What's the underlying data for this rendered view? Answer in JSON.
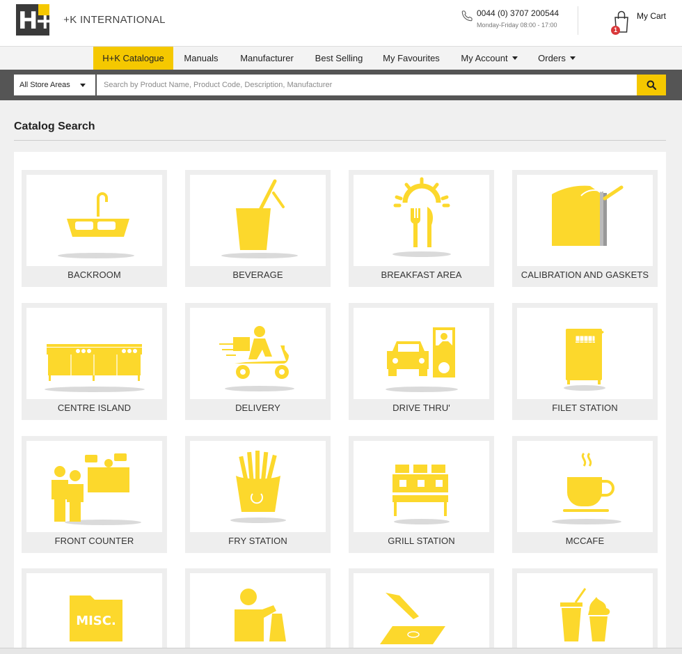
{
  "brand": {
    "logo_mark": "H+K",
    "name": "H+K INTERNATIONAL"
  },
  "contact": {
    "phone": "0044 (0) 3707 200544",
    "hours": "Monday-Friday 08:00 - 17:00",
    "icon": "phone-icon"
  },
  "cart": {
    "label": "My Cart",
    "count": "1",
    "icon": "shopping-bag-icon"
  },
  "nav": {
    "items": [
      {
        "label": "H+K Catalogue",
        "active": true,
        "dropdown": false
      },
      {
        "label": "Manuals",
        "active": false,
        "dropdown": false
      },
      {
        "label": "Manufacturer",
        "active": false,
        "dropdown": false
      },
      {
        "label": "Best Selling",
        "active": false,
        "dropdown": false
      },
      {
        "label": "My Favourites",
        "active": false,
        "dropdown": false
      },
      {
        "label": "My Account",
        "active": false,
        "dropdown": true
      },
      {
        "label": "Orders",
        "active": false,
        "dropdown": true
      }
    ]
  },
  "search": {
    "area_selected": "All Store Areas",
    "placeholder": "Search by Product Name, Product Code, Description, Manufacturer",
    "value": "",
    "button_icon": "search-icon"
  },
  "page": {
    "title": "Catalog Search"
  },
  "catalog": {
    "categories": [
      {
        "label": "BACKROOM",
        "icon": "sink-icon"
      },
      {
        "label": "BEVERAGE",
        "icon": "drink-cup-icon"
      },
      {
        "label": "BREAKFAST AREA",
        "icon": "sunrise-cutlery-icon"
      },
      {
        "label": "CALIBRATION AND GASKETS",
        "icon": "calibration-icon"
      },
      {
        "label": "CENTRE ISLAND",
        "icon": "kitchen-counter-icon"
      },
      {
        "label": "DELIVERY",
        "icon": "scooter-delivery-icon"
      },
      {
        "label": "DRIVE THRU'",
        "icon": "drive-thru-icon"
      },
      {
        "label": "FILET STATION",
        "icon": "fryer-icon"
      },
      {
        "label": "FRONT COUNTER",
        "icon": "front-counter-icon"
      },
      {
        "label": "FRY STATION",
        "icon": "fries-icon"
      },
      {
        "label": "GRILL STATION",
        "icon": "grill-station-icon"
      },
      {
        "label": "MCCAFE",
        "icon": "coffee-cup-icon"
      },
      {
        "label": "",
        "icon": "misc-folder-icon",
        "badge": "MISC."
      },
      {
        "label": "",
        "icon": "person-takeaway-bag-icon"
      },
      {
        "label": "",
        "icon": "cutting-board-icon"
      },
      {
        "label": "",
        "icon": "dessert-drinks-icon"
      }
    ]
  },
  "colors": {
    "accent": "#f5c800",
    "icon_yellow": "#fcd82c",
    "search_bar": "#555555",
    "badge": "#d9383a"
  }
}
